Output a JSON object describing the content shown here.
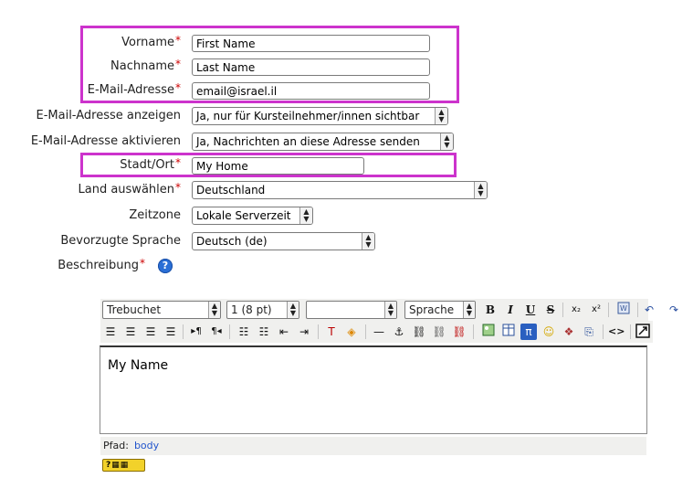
{
  "form": {
    "firstname": {
      "label": "Vorname",
      "required": "*",
      "value": "First Name"
    },
    "lastname": {
      "label": "Nachname",
      "required": "*",
      "value": "Last Name"
    },
    "email": {
      "label": "E-Mail-Adresse",
      "required": "*",
      "value": "email@israel.il"
    },
    "maildisplay": {
      "label": "E-Mail-Adresse anzeigen",
      "selected": "Ja, nur für Kursteilnehmer/innen sichtbar"
    },
    "emailstop": {
      "label": "E-Mail-Adresse aktivieren",
      "selected": "Ja, Nachrichten an diese Adresse senden"
    },
    "city": {
      "label": "Stadt/Ort",
      "required": "*",
      "value": "My Home"
    },
    "country": {
      "label": "Land auswählen",
      "required": "*",
      "selected": "Deutschland"
    },
    "timezone": {
      "label": "Zeitzone",
      "selected": "Lokale Serverzeit"
    },
    "language": {
      "label": "Bevorzugte Sprache",
      "selected": "Deutsch (de)"
    },
    "description": {
      "label": "Beschreibung",
      "required": "*",
      "help_icon": "?"
    }
  },
  "editor": {
    "font_family": "Trebuchet",
    "font_size": "1 (8 pt)",
    "heading": "",
    "language": "Sprache",
    "content": "My Name",
    "path_label": "Pfad:",
    "path_value": "body",
    "toolbar_row1": {
      "bold": "B",
      "italic": "I",
      "underline": "U",
      "strike": "S",
      "subscript": "x₂",
      "superscript": "x²"
    }
  },
  "colors": {
    "highlight": "#cc33cc",
    "required": "#cc0000",
    "toolbar_bg": "#f0f0ee"
  }
}
